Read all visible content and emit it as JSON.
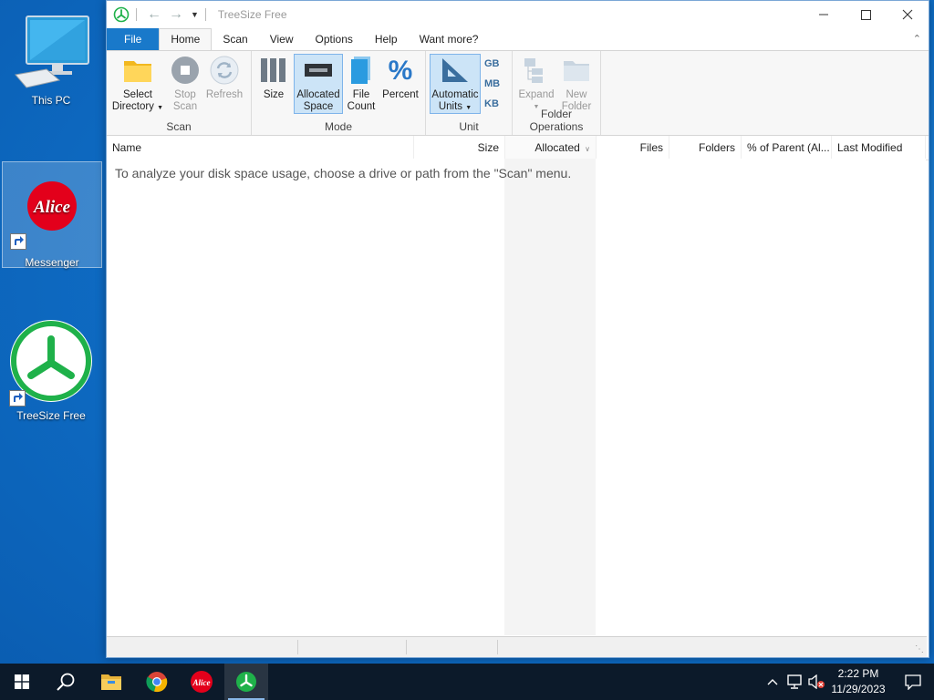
{
  "desktop": {
    "icons": [
      {
        "label": "This PC"
      },
      {
        "label": "Messenger",
        "logo_text": "Alice"
      },
      {
        "label": "TreeSize Free"
      }
    ]
  },
  "window": {
    "title": "TreeSize Free",
    "tabs": [
      {
        "label": "File"
      },
      {
        "label": "Home"
      },
      {
        "label": "Scan"
      },
      {
        "label": "View"
      },
      {
        "label": "Options"
      },
      {
        "label": "Help"
      },
      {
        "label": "Want more?"
      }
    ],
    "ribbon": {
      "scan_group": {
        "label": "Scan",
        "select_directory": [
          "Select",
          "Directory"
        ],
        "stop_scan": [
          "Stop",
          "Scan"
        ],
        "refresh": [
          "Refresh"
        ]
      },
      "mode_group": {
        "label": "Mode",
        "size": [
          "Size"
        ],
        "allocated_space": [
          "Allocated",
          "Space"
        ],
        "file_count": [
          "File",
          "Count"
        ],
        "percent": [
          "Percent"
        ]
      },
      "unit_group": {
        "label": "Unit",
        "automatic_units": [
          "Automatic",
          "Units"
        ],
        "gb": "GB",
        "mb": "MB",
        "kb": "KB"
      },
      "folder_group": {
        "label": "Folder Operations",
        "expand": [
          "Expand"
        ],
        "new_folder": [
          "New",
          "Folder"
        ]
      }
    },
    "columns": [
      "Name",
      "Size",
      "Allocated",
      "Files",
      "Folders",
      "% of Parent (Al...",
      "Last Modified"
    ],
    "empty_hint": "To analyze your disk space usage, choose a drive or path from the \"Scan\" menu."
  },
  "taskbar": {
    "time": "2:22 PM",
    "date": "11/29/2023",
    "messenger_logo_text": "Alice"
  },
  "colors": {
    "accent": "#1979ca",
    "treesize_green": "#1fb14a",
    "alice_red": "#e3001b"
  }
}
